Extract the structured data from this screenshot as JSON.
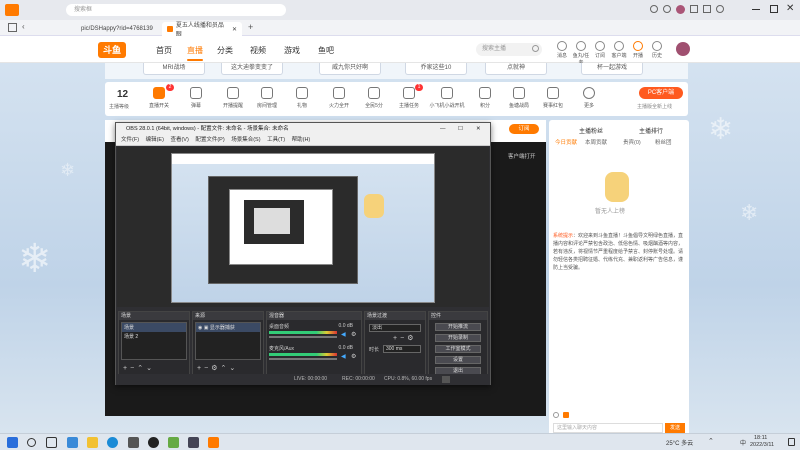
{
  "browser": {
    "search_placeholder": "搜索框",
    "address": "pic/DSHappy?rid=4768139",
    "tab_title": "夏五人线播和员品眼"
  },
  "site": {
    "logo_text": "斗鱼",
    "nav": [
      "首页",
      "直播",
      "分类",
      "视频",
      "游戏",
      "鱼吧"
    ],
    "search_placeholder": "搜索主播",
    "header_icons": [
      "消息",
      "鱼丸/任务",
      "订阅",
      "客户端",
      "开播",
      "历史"
    ]
  },
  "strip": [
    "MRI战场",
    "这大迪拳变变了",
    "威九你只好啊",
    "乔家这些10",
    "点就神",
    "杯一起游戏"
  ],
  "toolbar": {
    "level_num": "12",
    "level_label": "主播等级",
    "items": [
      "直播开关",
      "弹幕",
      "开播提醒",
      "房间管理",
      "礼物",
      "火力全开",
      "全民5分",
      "主播任务",
      "小飞机小战开机",
      "积分",
      "鱼塘战局",
      "赛事红包",
      "更多"
    ],
    "badge_1": "2",
    "badge_2": "1",
    "pc_button": "PC客户端",
    "pc_sub": "主播版全新上线"
  },
  "player": {
    "follow_label": "订阅",
    "client_label": "客户端打开"
  },
  "obs": {
    "title": "OBS 28.0.1 (64bit, windows) - 配置文件: 未命名 - 场景集合: 未命名",
    "menu": [
      "文件(F)",
      "编辑(E)",
      "查看(V)",
      "配置文件(P)",
      "场景集合(S)",
      "工具(T)",
      "帮助(H)"
    ],
    "docks": {
      "scenes": "场景",
      "sources": "来源",
      "mixer": "混音器",
      "transitions": "场景过渡",
      "controls": "控件"
    },
    "scenes_list": [
      "场景",
      "场景 2"
    ],
    "source_item": "显示器捕获",
    "mixer_rows": [
      {
        "name": "桌面音频",
        "value": "0.0 dB"
      },
      {
        "name": "麦克风/Aux",
        "value": "0.0 dB"
      }
    ],
    "transition": "淡出",
    "duration_label": "时长",
    "duration_value": "300 ms",
    "controls": [
      "开始推流",
      "开始录制",
      "工作室模式",
      "设置",
      "退出"
    ],
    "status": {
      "live": "LIVE: 00:00:00",
      "rec": "REC: 00:00:00",
      "cpu": "CPU: 0.8%, 60.00 fps"
    }
  },
  "right_panel": {
    "title_left": "主播粉丝",
    "title_right": "主播排行",
    "tabs": [
      "今日贡献",
      "本周贡献",
      "贵宾(0)",
      "粉丝团"
    ],
    "empty_text": "暂无人上榜",
    "notice_label": "系统提示",
    "notice_text": "欢迎来到斗鱼直播！斗鱼倡导文明绿色直播，直播内容和评论严禁包含政治、低俗色情、吸烟酗酒等内容，若有违反，将视情节严重程度给予禁言、封停账号处理。请勿轻信各类招聘征婚、代练代充、兼职返利等广告信息，谨防上当受骗。",
    "input_placeholder": "这里输入聊天内容",
    "send_label": "发送"
  },
  "taskbar": {
    "weather": "25°C 多云",
    "time": "18:11",
    "date": "2022/3/11",
    "lang": "中"
  },
  "colors": {
    "accent": "#ff7a00",
    "obs_bg": "#2f2f33",
    "player_bg": "#1a1a1a"
  }
}
